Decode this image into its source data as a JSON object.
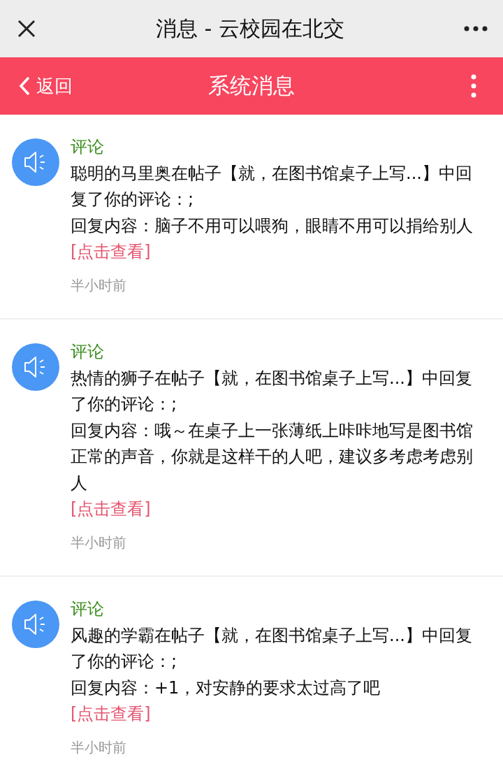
{
  "window": {
    "title": "消息 - 云校园在北交"
  },
  "nav": {
    "back": "返回",
    "title": "系统消息"
  },
  "messages": [
    {
      "category": "评论",
      "summary": "聪明的马里奥在帖子【就，在图书馆桌子上写...】中回复了你的评论：;",
      "reply": "回复内容：脑子不用可以喂狗，眼睛不用可以捐给别人",
      "link": "[点击查看]",
      "time": "半小时前"
    },
    {
      "category": "评论",
      "summary": "热情的狮子在帖子【就，在图书馆桌子上写...】中回复了你的评论：;",
      "reply": "回复内容：哦～在桌子上一张薄纸上咔咔地写是图书馆正常的声音，你就是这样干的人吧，建议多考虑考虑别人",
      "link": "[点击查看]",
      "time": "半小时前"
    },
    {
      "category": "评论",
      "summary": "风趣的学霸在帖子【就，在图书馆桌子上写...】中回复了你的评论：;",
      "reply": "回复内容：+1，对安静的要求太过高了吧",
      "link": "[点击查看]",
      "time": "半小时前"
    }
  ]
}
